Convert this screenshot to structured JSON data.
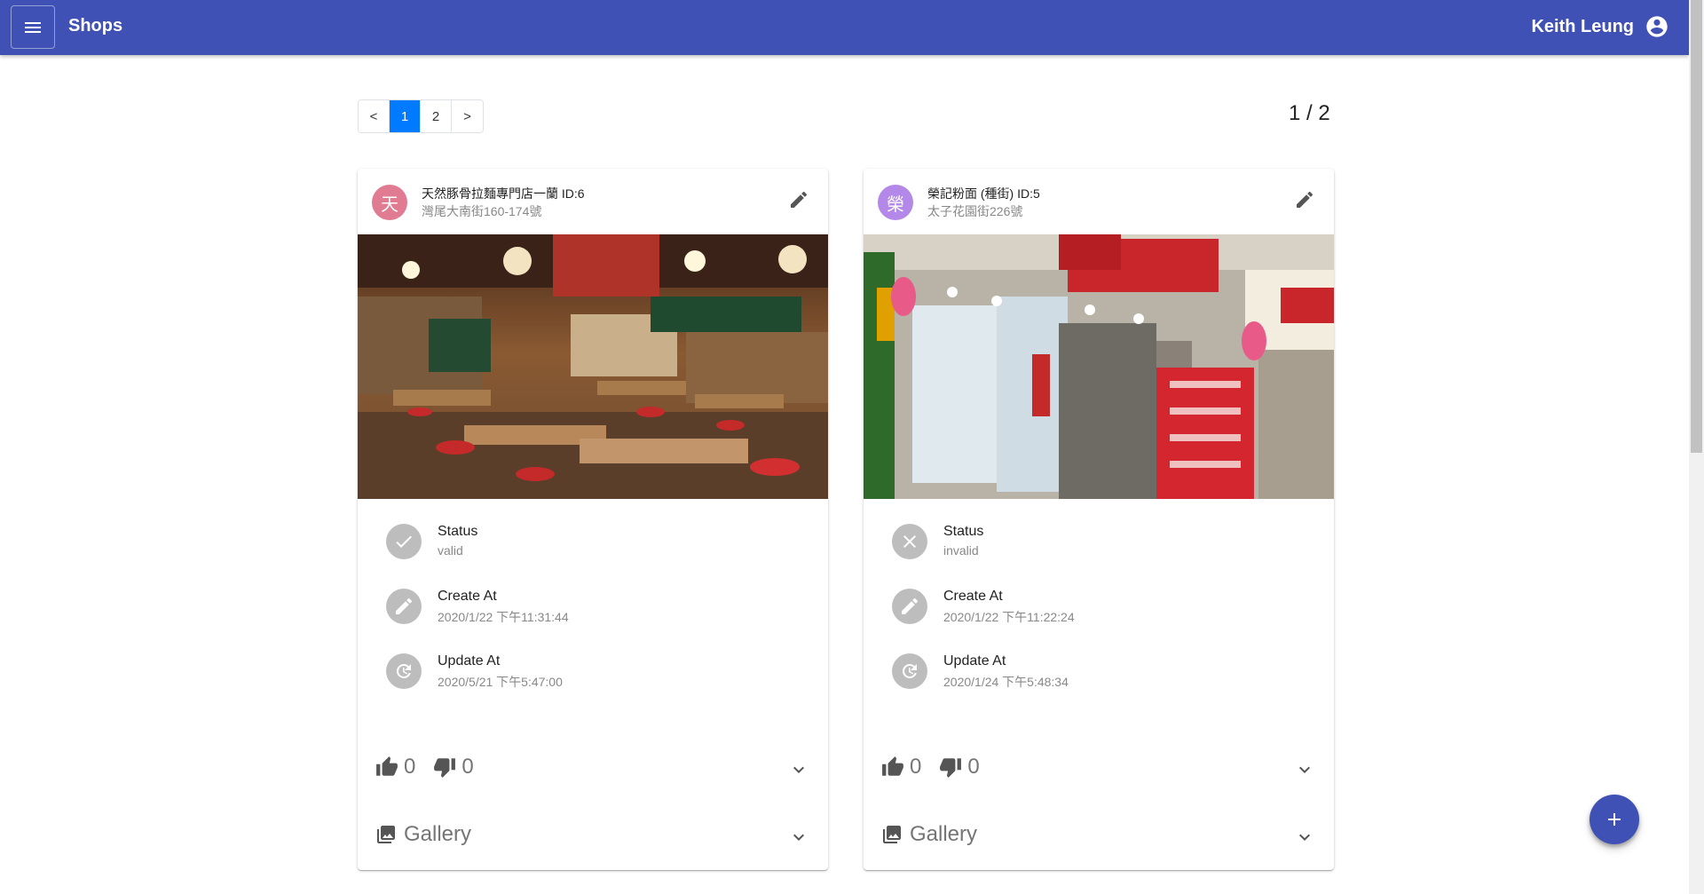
{
  "appbar": {
    "title": "Shops",
    "user_name": "Keith Leung",
    "menu_icon": "menu-icon",
    "account_icon": "account-circle-icon",
    "color": "#3f51b5"
  },
  "pagination": {
    "prev_label": "<",
    "pages": [
      "1",
      "2"
    ],
    "current_page": "1",
    "next_label": ">",
    "indicator": "1 / 2",
    "active_color": "#007bff"
  },
  "cards": [
    {
      "avatar_letter": "天",
      "avatar_color": "#e07b91",
      "title": "天然豚骨拉麵專門店一蘭 ID:6",
      "subtitle": "灣尾大南街160-174號",
      "image_description_icon": "restaurant-photo",
      "status_label": "Status",
      "status_value": "valid",
      "create_label": "Create At",
      "create_value": "2020/1/22 下午11:31:44",
      "update_label": "Update At",
      "update_value": "2020/5/21 下午5:47:00",
      "likes": "0",
      "dislikes": "0",
      "gallery_label": "Gallery"
    },
    {
      "avatar_letter": "榮",
      "avatar_color": "#b388e8",
      "title": "榮記粉面 (種街) ID:5",
      "subtitle": "太子花園街226號",
      "image_description_icon": "storefront-photo",
      "status_label": "Status",
      "status_value": "invalid",
      "create_label": "Create At",
      "create_value": "2020/1/22 下午11:22:24",
      "update_label": "Update At",
      "update_value": "2020/1/24 下午5:48:34",
      "likes": "0",
      "dislikes": "0",
      "gallery_label": "Gallery"
    }
  ],
  "fab": {
    "icon": "add-icon"
  }
}
